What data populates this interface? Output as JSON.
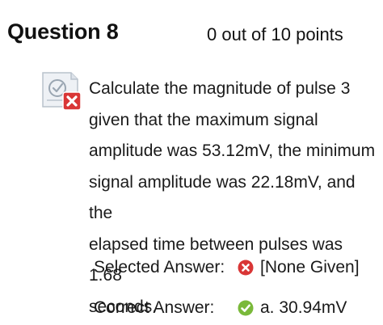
{
  "question": {
    "title": "Question 8",
    "score": "0 out of 10 points",
    "status_icon": "incorrect-quiz-icon",
    "lines": [
      "Calculate the magnitude of pulse 3",
      "given that the maximum signal",
      "amplitude was 53.12mV, the minimum",
      "signal amplitude was 22.18mV, and the",
      "elapsed time between pulses was 1.68",
      "seconds."
    ]
  },
  "selected_answer": {
    "label": "Selected Answer:",
    "value": "[None Given]",
    "icon": "x-circle-icon"
  },
  "correct_answer": {
    "label": "Correct Answer:",
    "value": "a. 30.94mV",
    "icon": "check-circle-icon"
  },
  "colors": {
    "incorrect_red": "#d93636",
    "correct_green": "#7ab93a",
    "text": "#1a1a1a"
  }
}
